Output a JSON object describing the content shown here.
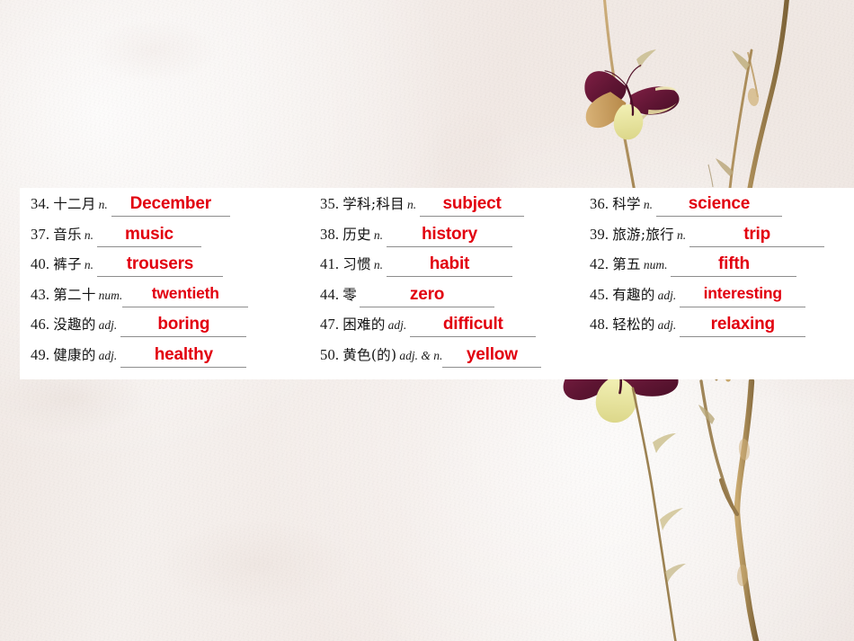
{
  "slide": {
    "background_color": "#f4eeea",
    "panel_color": "#ffffff",
    "answer_color": "#e2000f",
    "blank_rule_color": "#8d8d8d",
    "decor": {
      "branch_color": "#b89a6a",
      "butterfly_wing_dark": "#6d1a3c",
      "butterfly_wing_light": "#e9e9a0",
      "butterfly_wing_tan": "#c9a063"
    }
  },
  "worksheet": {
    "rows": [
      [
        {
          "num": "34.",
          "cn": "十二月",
          "pos": "n.",
          "answer": "December"
        },
        {
          "num": "35.",
          "cn": "学科;科目",
          "pos": "n.",
          "answer": "subject"
        },
        {
          "num": "36.",
          "cn": "科学",
          "pos": "n.",
          "answer": "science"
        }
      ],
      [
        {
          "num": "37.",
          "cn": "音乐",
          "pos": "n.",
          "answer": "music"
        },
        {
          "num": "38.",
          "cn": "历史",
          "pos": "n.",
          "answer": "history"
        },
        {
          "num": "39.",
          "cn": "旅游;旅行",
          "pos": "n.",
          "answer": "trip"
        }
      ],
      [
        {
          "num": "40.",
          "cn": "裤子",
          "pos": "n.",
          "answer": "trousers"
        },
        {
          "num": "41.",
          "cn": "习惯",
          "pos": "n.",
          "answer": "habit"
        },
        {
          "num": "42.",
          "cn": "第五",
          "pos": "num.",
          "answer": "fifth"
        }
      ],
      [
        {
          "num": "43.",
          "cn": "第二十",
          "pos": "num.",
          "answer": "twentieth"
        },
        {
          "num": "44.",
          "cn": "零",
          "pos": "",
          "answer": "zero"
        },
        {
          "num": "45.",
          "cn": "有趣的",
          "pos": "adj.",
          "answer": "interesting"
        }
      ],
      [
        {
          "num": "46.",
          "cn": "没趣的",
          "pos": "adj.",
          "answer": "boring"
        },
        {
          "num": "47.",
          "cn": "困难的",
          "pos": "adj.",
          "answer": "difficult"
        },
        {
          "num": "48.",
          "cn": "轻松的",
          "pos": "adj.",
          "answer": "relaxing"
        }
      ],
      [
        {
          "num": "49.",
          "cn": "健康的",
          "pos": "adj.",
          "answer": "healthy"
        },
        {
          "num": "50.",
          "cn": "黄色(的)",
          "pos": "adj. & n.",
          "answer": "yellow"
        },
        {
          "num": "",
          "cn": "",
          "pos": "",
          "answer": ""
        }
      ]
    ]
  }
}
